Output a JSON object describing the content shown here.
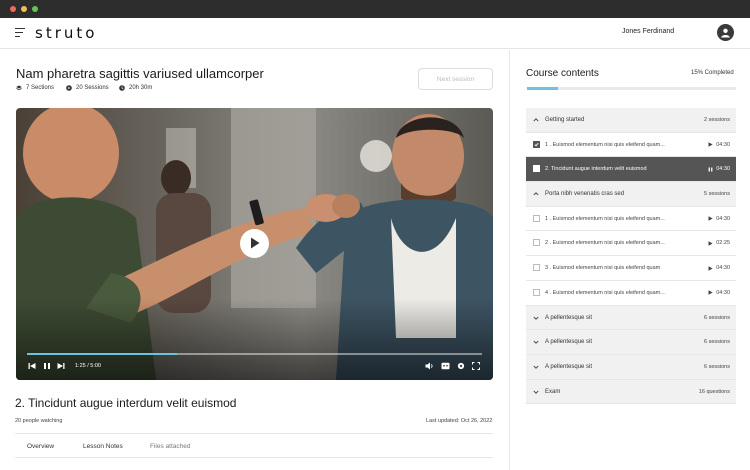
{
  "header": {
    "logo": "struto",
    "user_name": "Jones Ferdinand"
  },
  "course": {
    "title": "Nam pharetra sagittis variused ullamcorper",
    "sections": "7 Sections",
    "sessions": "20 Sessions",
    "duration": "20h 30m",
    "next_button": "Next session"
  },
  "player": {
    "time": "1:25 / 5:00",
    "progress": 0.33
  },
  "lesson": {
    "title": "2. Tincidunt augue interdum velit euismod",
    "watching": "20 people watching",
    "updated": "Last updated: Oct 26, 2022"
  },
  "tabs": [
    "Overview",
    "Lesson Notes",
    "Files attached"
  ],
  "sidebar": {
    "title": "Course contents",
    "completed_label": "15% Completed",
    "completed": 0.15,
    "sections": [
      {
        "label": "Getting started",
        "count": "2 sessions"
      },
      {
        "label": "Porta nibh venenatis cras sed",
        "count": "5 sessions"
      },
      {
        "label": "A pellentesque sit",
        "count": "6 sessions"
      },
      {
        "label": "A pellentesque sit",
        "count": "6 sessions"
      },
      {
        "label": "A pellentesque sit",
        "count": "6 sessions"
      },
      {
        "label": "Exam",
        "count": "16 questions"
      }
    ],
    "lessons": [
      {
        "label": "1 . Euismod elementum nisi quis eleifend quam...",
        "time": "04:30",
        "checked": true
      },
      {
        "label": "2. Tincidunt augue interdum velit euismod",
        "time": "04:30",
        "active": true
      },
      {
        "label": "1 . Euismod elementum nisi quis eleifend quam...",
        "time": "04:30"
      },
      {
        "label": "2 . Euismod elementum nisi quis eleifend quam...",
        "time": "02:25"
      },
      {
        "label": "3 . Euismod elementum nisi quis eleifend quam",
        "time": "04:30"
      },
      {
        "label": "4 . Euismod elementum nisi quis eleifend quam...",
        "time": "04:30"
      }
    ]
  },
  "colors": {
    "accent": "#6cc3e0",
    "active_row": "#555555"
  }
}
